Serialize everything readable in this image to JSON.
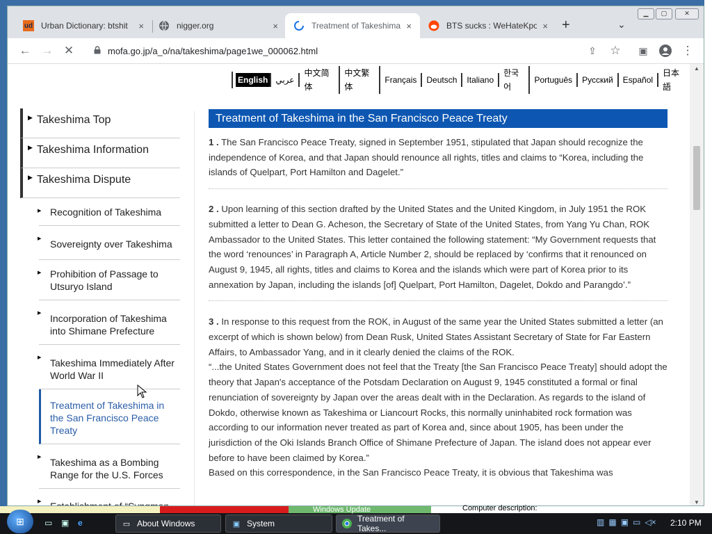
{
  "tabs": [
    {
      "title": "Urban Dictionary: btshit",
      "icon": "urban-dictionary-icon",
      "close": "×"
    },
    {
      "title": "nigger.org",
      "icon": "globe-icon",
      "close": "×"
    },
    {
      "title": "Treatment of Takeshima",
      "icon": "loading-spinner-icon",
      "close": "×"
    },
    {
      "title": "BTS sucks : WeHateKpop",
      "icon": "reddit-icon",
      "close": "×"
    }
  ],
  "toolbar": {
    "url": "mofa.go.jp/a_o/na/takeshima/page1we_000062.html"
  },
  "languages": [
    "English",
    "عربي",
    "中文简体",
    "中文繁体",
    "Français",
    "Deutsch",
    "Italiano",
    "한국어",
    "Português",
    "Русский",
    "Español",
    "日本語"
  ],
  "sidebar": {
    "top": [
      "Takeshima Top",
      "Takeshima Information",
      "Takeshima Dispute"
    ],
    "sub": [
      "Recognition of Takeshima",
      "Sovereignty over Takeshima",
      "Prohibition of Passage to Utsuryo Island",
      "Incorporation of Takeshima into Shimane Prefecture",
      "Takeshima Immediately After World War II",
      "Treatment of Takeshima in the San Francisco Peace Treaty",
      "Takeshima as a Bombing Range for the U.S. Forces",
      "Establishment of “Syngman"
    ],
    "active_index": 5
  },
  "main": {
    "title": "Treatment of Takeshima in the San Francisco Peace Treaty",
    "p1_num": "1 .",
    "p1": "The San Francisco Peace Treaty, signed in September 1951, stipulated that Japan should recognize the independence of Korea, and that Japan should renounce all rights, titles and claims to “Korea, including the islands of Quelpart, Port Hamilton and Dagelet.”",
    "p2_num": "2 .",
    "p2": "Upon learning of this section drafted by the United States and the United Kingdom, in July 1951 the ROK submitted a letter to Dean G. Acheson, the Secretary of State of the United States, from Yang Yu Chan, ROK Ambassador to the United States. This letter contained the following statement: “My Government requests that the word ‘renounces’ in Paragraph A, Article Number 2, should be replaced by ‘confirms that it renounced on August 9, 1945, all rights, titles and claims to Korea and the islands which were part of Korea prior to its annexation by Japan, including the islands [of] Quelpart, Port Hamilton, Dagelet, Dokdo and Parangdo’.”",
    "p3_num": "3 .",
    "p3": "In response to this request from the ROK, in August of the same year the United States submitted a letter (an excerpt of which is shown below) from Dean Rusk, United States Assistant Secretary of State for Far Eastern Affairs, to Ambassador Yang, and in it clearly denied the claims of the ROK.",
    "p3_quote": "“...the United States Government does not feel that the Treaty [the San Francisco Peace Treaty] should adopt the theory that Japan's acceptance of the Potsdam Declaration on August 9, 1945 constituted a formal or final renunciation of sovereignty by Japan over the areas dealt with in the Declaration. As regards to the island of Dokdo, otherwise known as Takeshima or Liancourt Rocks, this normally uninhabited rock formation was according to our information never treated as part of Korea and, since about 1905, has been under the jurisdiction of the Oki Islands Branch Office of Shimane Prefecture of Japan. The island does not appear ever before to have been claimed by Korea.”",
    "p3_tail": "Based on this correspondence, in the San Francisco Peace Treaty, it is obvious that Takeshima was"
  },
  "taskbar": {
    "windows_update": "Windows Update",
    "computer_description": "Computer description:",
    "buttons": [
      "About Windows",
      "System",
      "Treatment of Takes..."
    ],
    "clock": "2:10 PM"
  },
  "colors": {
    "heading_bar": "#0d57b2",
    "active_link": "#2a5ea8"
  }
}
